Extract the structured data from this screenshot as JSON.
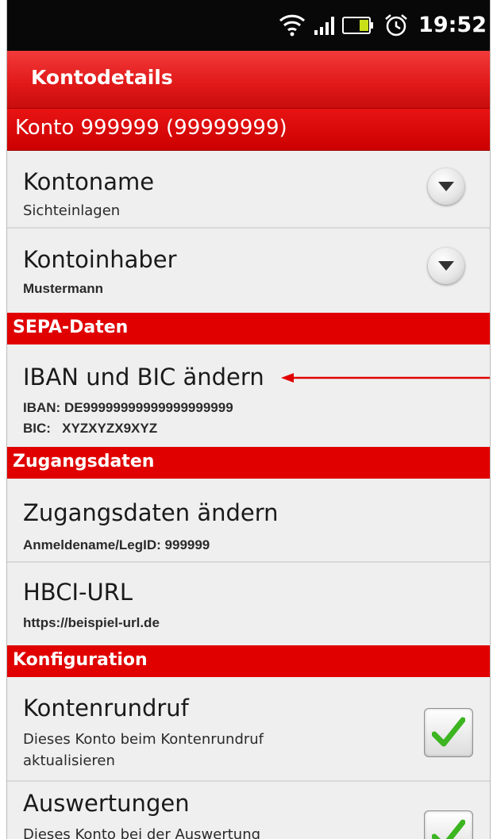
{
  "status": {
    "time": "19:52"
  },
  "header": {
    "title": "Kontodetails"
  },
  "account": {
    "label": "Konto 999999 (99999999)"
  },
  "rows": {
    "kontoname": {
      "title": "Kontoname",
      "value": "Sichteinlagen"
    },
    "kontoinhaber": {
      "title": "Kontoinhaber",
      "value": "Mustermann"
    },
    "iban_bic": {
      "title": "IBAN und BIC ändern",
      "iban": "IBAN: DE99999999999999999999",
      "bic": "BIC:   XYZXYZX9XYZ"
    },
    "zugangsdaten": {
      "title": "Zugangsdaten ändern",
      "value": "Anmeldename/LegID: 999999"
    },
    "hbci": {
      "title": "HBCI-URL",
      "value": "https://beispiel-url.de"
    },
    "kontenrundruf": {
      "title": "Kontenrundruf",
      "desc_line1": "Dieses Konto beim Kontenrundruf",
      "desc_line2": "aktualisieren",
      "checked": true
    },
    "auswertungen": {
      "title": "Auswertungen",
      "desc_line1": "Dieses Konto bei der Auswertung",
      "checked": true
    }
  },
  "sections": {
    "sepa": "SEPA-Daten",
    "zugang": "Zugangsdaten",
    "konfig": "Konfiguration"
  },
  "colors": {
    "accent": "#e00000",
    "background": "#efefef",
    "check": "#3cb521"
  },
  "icons": [
    "wifi-icon",
    "signal-icon",
    "battery-icon",
    "alarm-icon",
    "dropdown-icon",
    "checkmark-icon",
    "annotation-arrow"
  ]
}
